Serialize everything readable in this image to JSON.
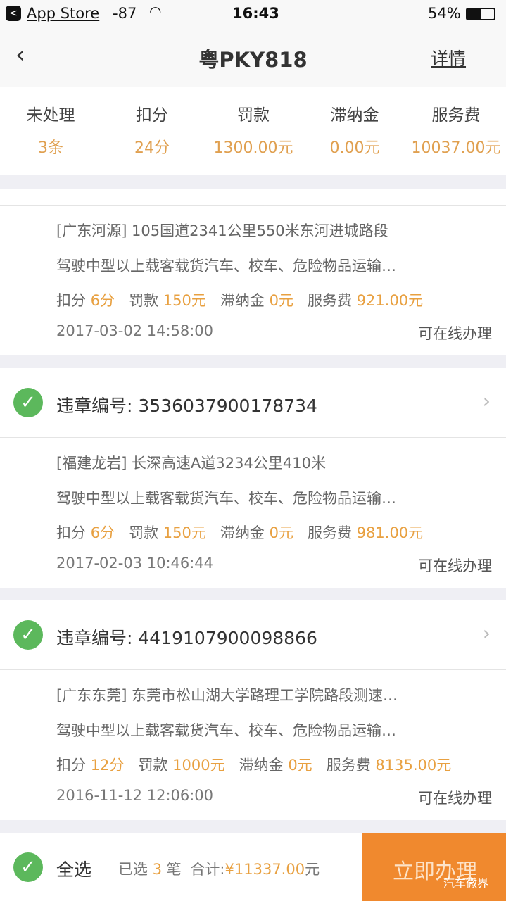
{
  "status_bar": {
    "back_app": "App Store",
    "signal": "-87",
    "time": "16:43",
    "battery": "54%"
  },
  "nav": {
    "title": "粤PKY818",
    "detail": "详情"
  },
  "summary": [
    {
      "label": "未处理",
      "value": "3条"
    },
    {
      "label": "扣分",
      "value": "24分"
    },
    {
      "label": "罚款",
      "value": "1300.00元"
    },
    {
      "label": "滞纳金",
      "value": "0.00元"
    },
    {
      "label": "服务费",
      "value": "10037.00元"
    }
  ],
  "violations": [
    {
      "id_label": "",
      "id": "",
      "location": "[广东河源] 105国道2341公里550米东河进城路段",
      "desc": "驾驶中型以上载客载货汽车、校车、危险物品运输…",
      "points_label": "扣分",
      "points": "6分",
      "fine_label": "罚款",
      "fine": "150元",
      "late_label": "滞纳金",
      "late": "0元",
      "fee_label": "服务费",
      "fee": "921.00元",
      "time": "2017-03-02 14:58:00",
      "status": "可在线办理"
    },
    {
      "id_label": "违章编号:",
      "id": "3536037900178734",
      "location": "[福建龙岩] 长深高速A道3234公里410米",
      "desc": "驾驶中型以上载客载货汽车、校车、危险物品运输…",
      "points_label": "扣分",
      "points": "6分",
      "fine_label": "罚款",
      "fine": "150元",
      "late_label": "滞纳金",
      "late": "0元",
      "fee_label": "服务费",
      "fee": "981.00元",
      "time": "2017-02-03 10:46:44",
      "status": "可在线办理"
    },
    {
      "id_label": "违章编号:",
      "id": "4419107900098866",
      "location": "[广东东莞] 东莞市松山湖大学路理工学院路段测速…",
      "desc": "驾驶中型以上载客载货汽车、校车、危险物品运输…",
      "points_label": "扣分",
      "points": "12分",
      "fine_label": "罚款",
      "fine": "1000元",
      "late_label": "滞纳金",
      "late": "0元",
      "fee_label": "服务费",
      "fee": "8135.00元",
      "time": "2016-11-12 12:06:00",
      "status": "可在线办理"
    }
  ],
  "footer": {
    "select_all": "全选",
    "selected_prefix": "已选",
    "selected_count": "3",
    "selected_suffix": "笔",
    "total_label": "合计:",
    "total": "¥11337.00",
    "total_unit": "元",
    "action": "立即办理",
    "watermark": "汽车微界"
  },
  "colors": {
    "accent": "#e8a040",
    "button": "#f0892e",
    "check": "#5cb85c"
  }
}
